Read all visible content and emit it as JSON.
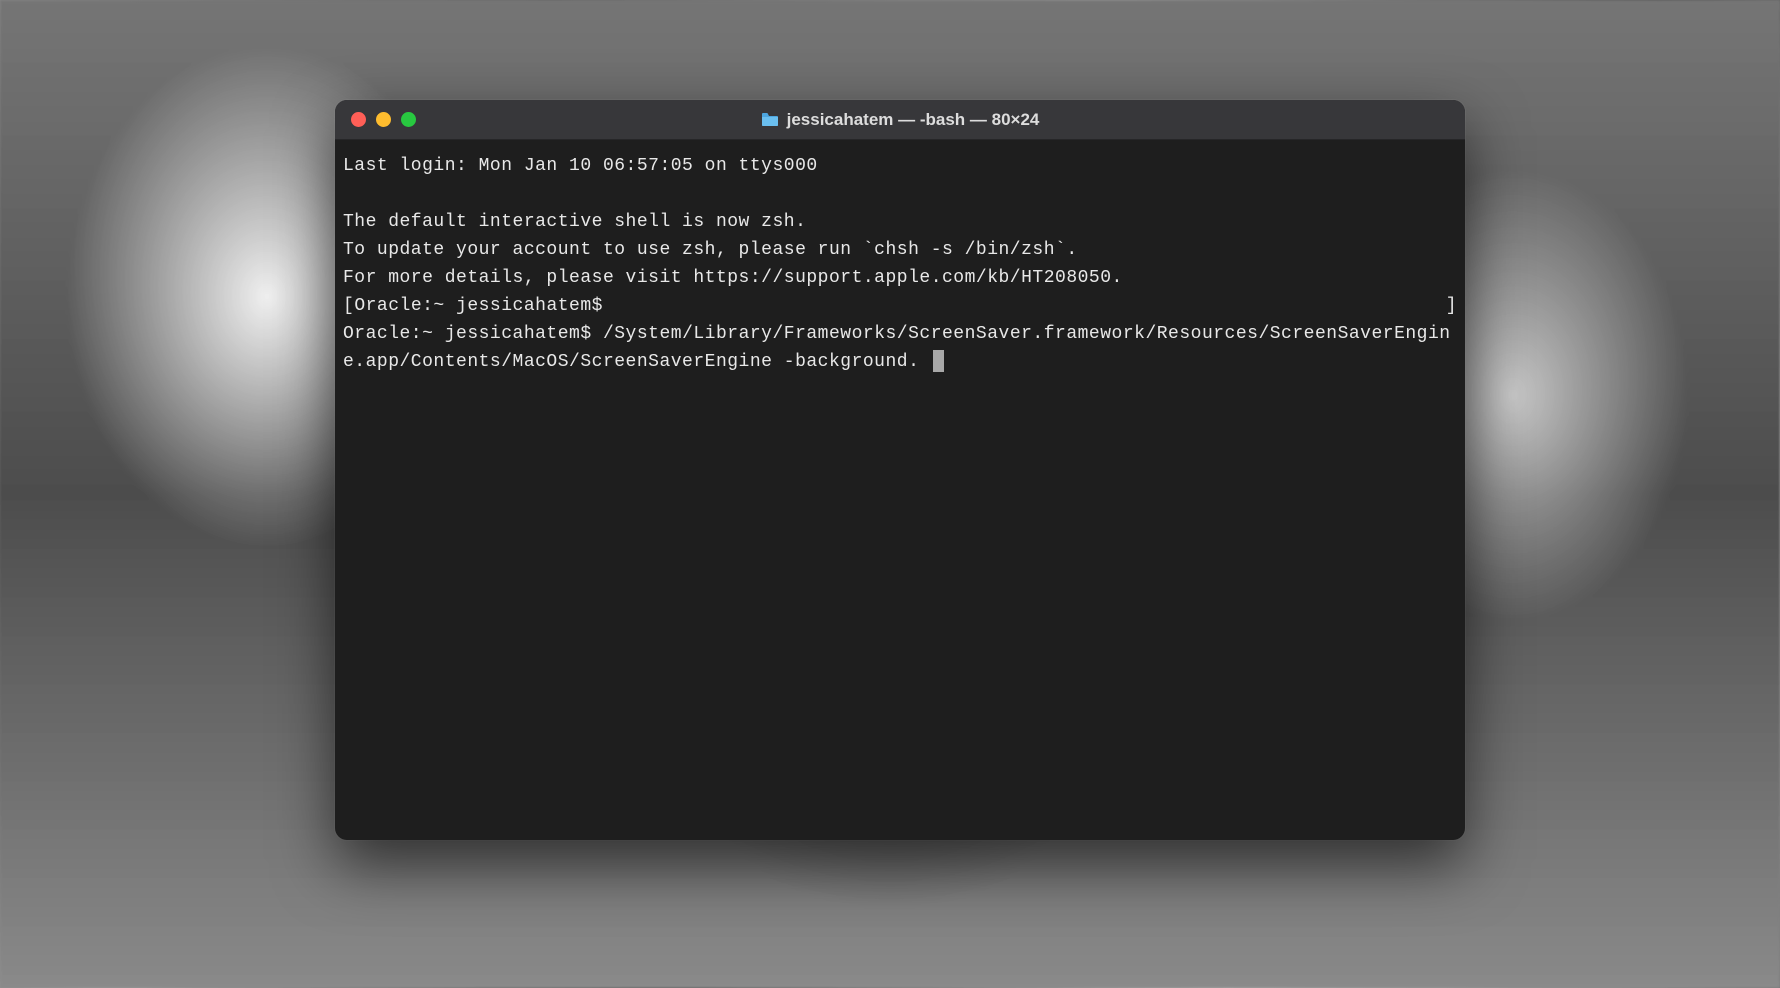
{
  "window": {
    "title": "jessicahatem — -bash — 80×24"
  },
  "terminal": {
    "line1": "Last login: Mon Jan 10 06:57:05 on ttys000",
    "line2": "",
    "line3": "The default interactive shell is now zsh.",
    "line4": "To update your account to use zsh, please run `chsh -s /bin/zsh`.",
    "line5": "For more details, please visit https://support.apple.com/kb/HT208050.",
    "line6_open": "[",
    "line6_content": "Oracle:~ jessicahatem$",
    "line6_close": "]",
    "line7_prompt": "Oracle:~ jessicahatem$ ",
    "line7_command": "/System/Library/Frameworks/ScreenSaver.framework/Resources/ScreenSaverEngine.app/Contents/MacOS/ScreenSaverEngine -background. "
  }
}
